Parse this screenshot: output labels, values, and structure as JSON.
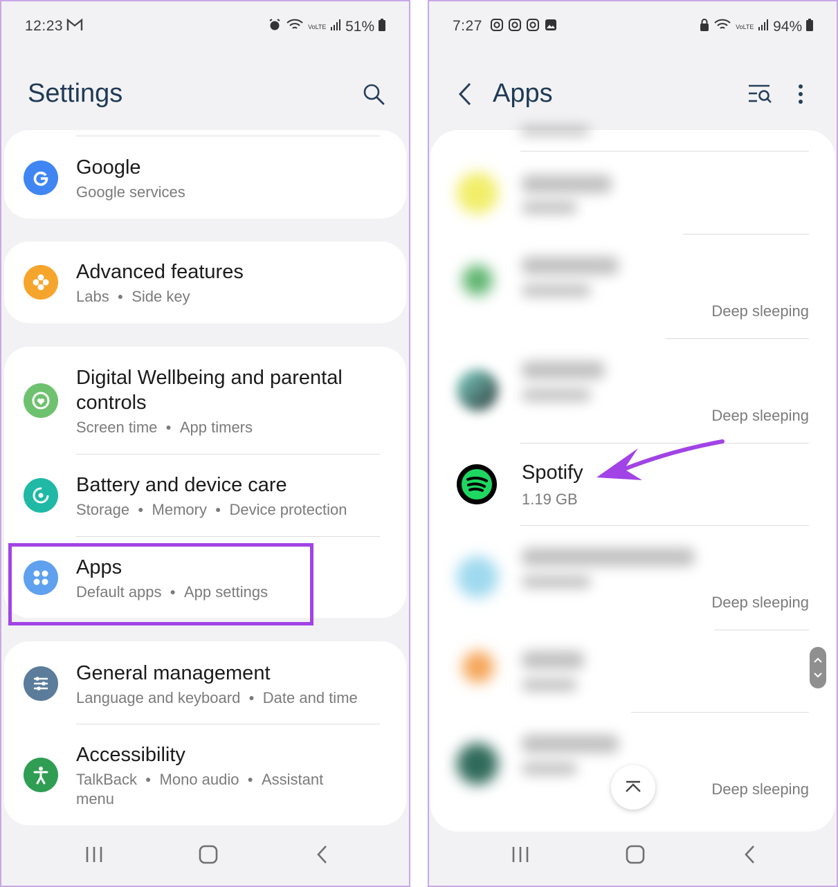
{
  "left": {
    "status": {
      "time": "12:23",
      "battery": "51%"
    },
    "title": "Settings",
    "items": [
      {
        "title": "Google",
        "sub": [
          "Google services"
        ]
      },
      {
        "title": "Advanced features",
        "sub": [
          "Labs",
          "Side key"
        ]
      },
      {
        "title": "Digital Wellbeing and parental",
        "title2": "controls",
        "sub": [
          "Screen time",
          "App timers"
        ]
      },
      {
        "title": "Battery and device care",
        "sub": [
          "Storage",
          "Memory",
          "Device protection"
        ]
      },
      {
        "title": "Apps",
        "sub": [
          "Default apps",
          "App settings"
        ]
      },
      {
        "title": "General management",
        "sub": [
          "Language and keyboard",
          "Date and time"
        ]
      },
      {
        "title": "Accessibility",
        "sub": [
          "TalkBack",
          "Mono audio",
          "Assistant"
        ],
        "sub2": "menu"
      }
    ],
    "colors": {
      "google": "#3f86f3",
      "advanced": "#f6a52c",
      "wellbeing": "#6ec26f",
      "battery": "#1fb9a6",
      "apps": "#5fa0ef",
      "general": "#5b7c9b",
      "accessibility": "#2f9e53",
      "highlight": "#a143e6"
    }
  },
  "right": {
    "status": {
      "time": "7:27",
      "battery": "94%"
    },
    "title": "Apps",
    "deep_sleeping": "Deep sleeping",
    "spotify": {
      "name": "Spotify",
      "size": "1.19 GB"
    },
    "arrow_color": "#a143e6"
  }
}
